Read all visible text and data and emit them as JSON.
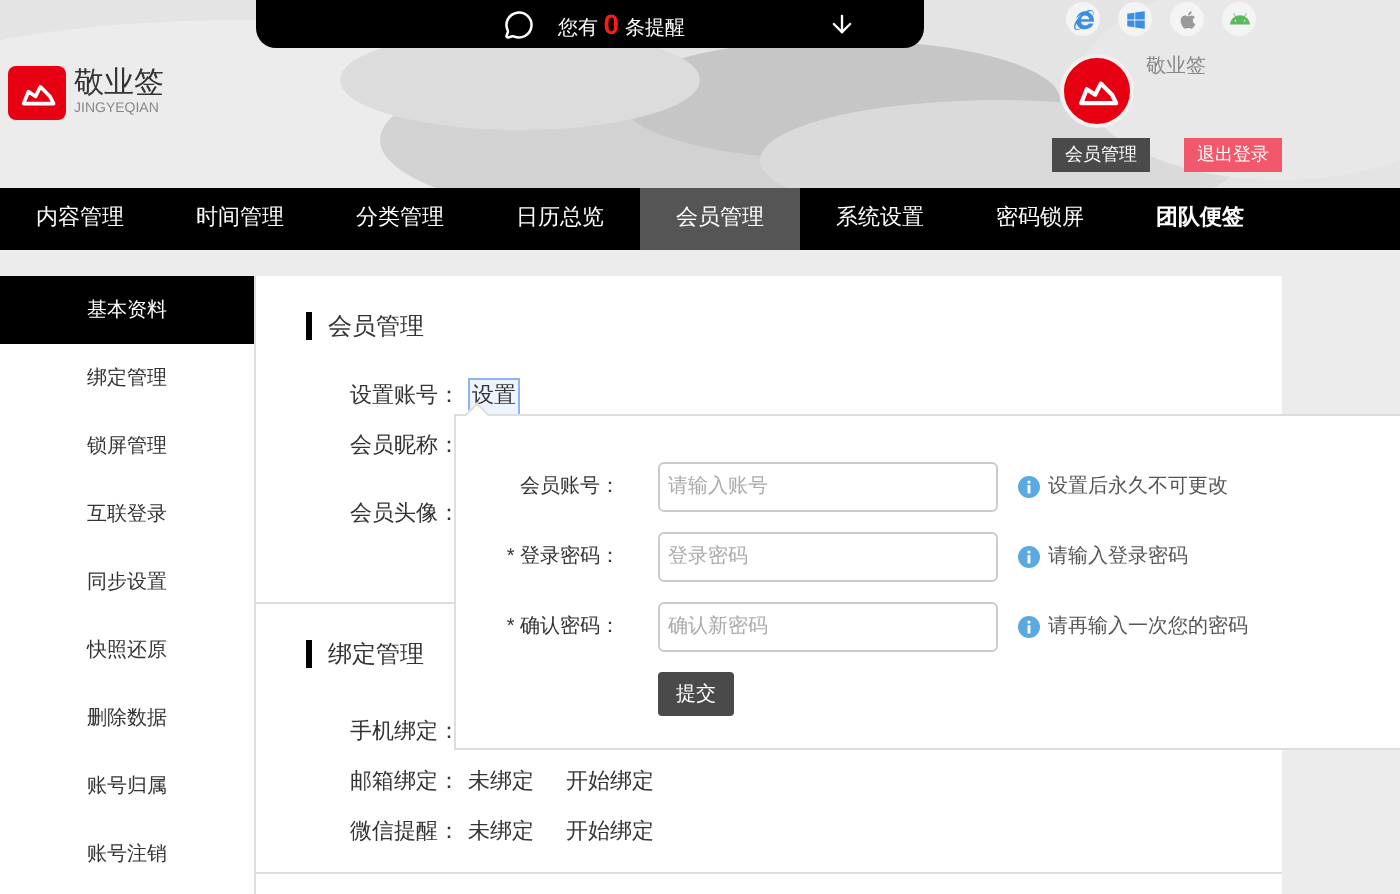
{
  "notification": {
    "prefix": "您有",
    "count": "0",
    "suffix": "条提醒"
  },
  "brand": {
    "name": "敬业签",
    "subtitle": "JINGYEQIAN"
  },
  "user": {
    "name": "敬业签",
    "buttons": [
      {
        "label": "会员管理",
        "kind": "account"
      },
      {
        "label": "退出登录",
        "kind": "logout"
      }
    ]
  },
  "nav": [
    {
      "label": "内容管理",
      "selected": false,
      "emphasized": false
    },
    {
      "label": "时间管理",
      "selected": false,
      "emphasized": false
    },
    {
      "label": "分类管理",
      "selected": false,
      "emphasized": false
    },
    {
      "label": "日历总览",
      "selected": false,
      "emphasized": false
    },
    {
      "label": "会员管理",
      "selected": true,
      "emphasized": false
    },
    {
      "label": "系统设置",
      "selected": false,
      "emphasized": false
    },
    {
      "label": "密码锁屏",
      "selected": false,
      "emphasized": false
    },
    {
      "label": "团队便签",
      "selected": false,
      "emphasized": true
    }
  ],
  "sidebar": [
    {
      "label": "基本资料",
      "selected": true
    },
    {
      "label": "绑定管理",
      "selected": false
    },
    {
      "label": "锁屏管理",
      "selected": false
    },
    {
      "label": "互联登录",
      "selected": false
    },
    {
      "label": "同步设置",
      "selected": false
    },
    {
      "label": "快照还原",
      "selected": false
    },
    {
      "label": "删除数据",
      "selected": false
    },
    {
      "label": "账号归属",
      "selected": false
    },
    {
      "label": "账号注销",
      "selected": false
    }
  ],
  "sections": [
    {
      "title": "会员管理",
      "rows": [
        {
          "kind": "text",
          "label": "设置账号：",
          "action": "设置"
        },
        {
          "kind": "text",
          "label": "会员昵称："
        },
        {
          "kind": "avatar",
          "label": "会员头像："
        }
      ]
    },
    {
      "title": "绑定管理",
      "rows": [
        {
          "kind": "text",
          "label": "手机绑定："
        },
        {
          "kind": "text",
          "label": "邮箱绑定：",
          "value": "未绑定",
          "action": "开始绑定"
        },
        {
          "kind": "text",
          "label": "微信提醒：",
          "value": "未绑定",
          "action": "开始绑定"
        }
      ]
    }
  ],
  "popover": {
    "fields": [
      {
        "label": "会员账号：",
        "placeholder": "请输入账号",
        "hint": "设置后永久不可更改"
      },
      {
        "label": "* 登录密码：",
        "placeholder": "登录密码",
        "hint": "请输入登录密码"
      },
      {
        "label": "* 确认密码：",
        "placeholder": "确认新密码",
        "hint": "请再输入一次您的密码"
      }
    ],
    "submit": "提交"
  }
}
